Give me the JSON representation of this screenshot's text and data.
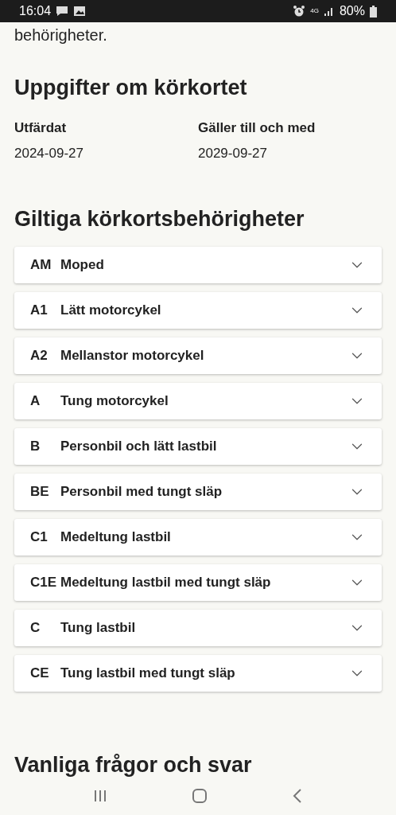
{
  "status_bar": {
    "time": "16:04",
    "network": "4G",
    "battery": "80%"
  },
  "intro_tail": "behörigheter.",
  "license_section": {
    "title": "Uppgifter om körkortet",
    "fields": [
      {
        "label": "Utfärdat",
        "value": "2024-09-27"
      },
      {
        "label": "Gäller till och med",
        "value": "2029-09-27"
      }
    ]
  },
  "categories_section": {
    "title": "Giltiga körkortsbehörigheter",
    "items": [
      {
        "code": "AM",
        "name": "Moped",
        "expanded": false
      },
      {
        "code": "A1",
        "name": "Lätt motorcykel",
        "expanded": false
      },
      {
        "code": "A2",
        "name": "Mellanstor motorcykel",
        "expanded": false
      },
      {
        "code": "A",
        "name": "Tung motorcykel",
        "expanded": false
      },
      {
        "code": "B",
        "name": "Personbil och lätt lastbil",
        "expanded": false
      },
      {
        "code": "BE",
        "name": "Personbil med tungt släp",
        "expanded": false
      },
      {
        "code": "C1",
        "name": "Medeltung lastbil",
        "expanded": false
      },
      {
        "code": "C1E",
        "name": "Medeltung lastbil med tungt släp",
        "expanded": false
      },
      {
        "code": "C",
        "name": "Tung lastbil",
        "expanded": false
      },
      {
        "code": "CE",
        "name": "Tung lastbil med tungt släp",
        "expanded": false
      }
    ]
  },
  "faq_title": "Vanliga frågor och svar"
}
